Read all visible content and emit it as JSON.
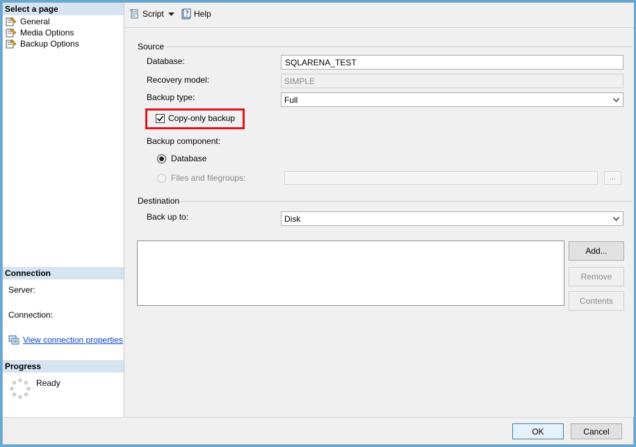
{
  "left_pane": {
    "select_page_header": "Select a page",
    "pages": [
      {
        "label": "General"
      },
      {
        "label": "Media Options"
      },
      {
        "label": "Backup Options"
      }
    ],
    "connection_header": "Connection",
    "server_label": "Server:",
    "connection_label": "Connection:",
    "view_connection_link": "View connection properties",
    "progress_header": "Progress",
    "progress_status": "Ready"
  },
  "toolbar": {
    "script_label": "Script",
    "help_label": "Help"
  },
  "source": {
    "group_title": "Source",
    "database_label": "Database:",
    "database_value": "SQLARENA_TEST",
    "recovery_model_label": "Recovery model:",
    "recovery_model_value": "SIMPLE",
    "backup_type_label": "Backup type:",
    "backup_type_value": "Full",
    "copy_only_label": "Copy-only backup",
    "copy_only_checked": true,
    "backup_component_label": "Backup component:",
    "component_database_label": "Database",
    "component_files_label": "Files and filegroups:",
    "browse_label": "..."
  },
  "destination": {
    "group_title": "Destination",
    "back_up_to_label": "Back up to:",
    "back_up_to_value": "Disk",
    "add_label": "Add...",
    "remove_label": "Remove",
    "contents_label": "Contents"
  },
  "footer": {
    "ok_label": "OK",
    "cancel_label": "Cancel"
  },
  "colors": {
    "highlight": "#e0121e",
    "header_bg": "#d6e4f1",
    "link": "#0645c5"
  }
}
